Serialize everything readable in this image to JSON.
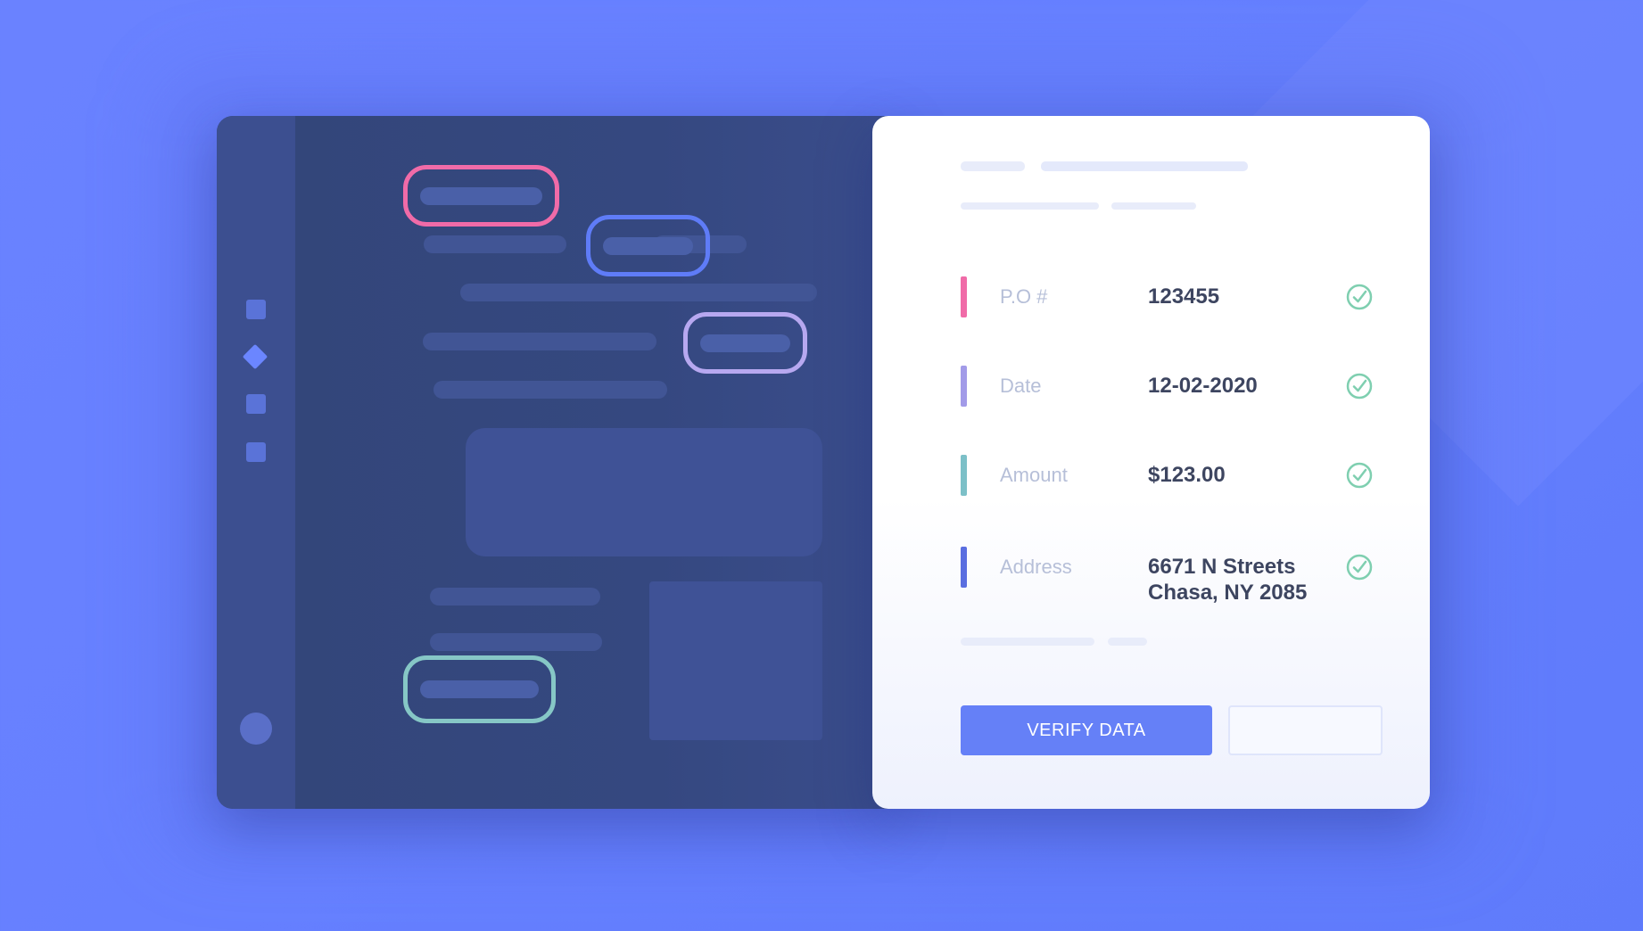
{
  "fields": [
    {
      "label": "P.O #",
      "value": "123455",
      "accent": "#f06ba8"
    },
    {
      "label": "Date",
      "value": "12-02-2020",
      "accent": "#a29be8"
    },
    {
      "label": "Amount",
      "value": "$123.00",
      "accent": "#7cc0c8"
    },
    {
      "label": "Address",
      "value_line1": "6671 N Streets",
      "value_line2": "Chasa, NY 2085",
      "accent": "#5a6ee0"
    }
  ],
  "actions": {
    "verify_label": "VERIFY DATA",
    "secondary_label": ""
  },
  "colors": {
    "primary": "#6580f7",
    "check": "#7fcfb0",
    "highlight_pink": "#f06ba8",
    "highlight_blue": "#5f7cf7",
    "highlight_lavender": "#b7a8f0",
    "highlight_teal": "#86c7c6"
  },
  "icons": {
    "verified": "check-circle-icon"
  }
}
